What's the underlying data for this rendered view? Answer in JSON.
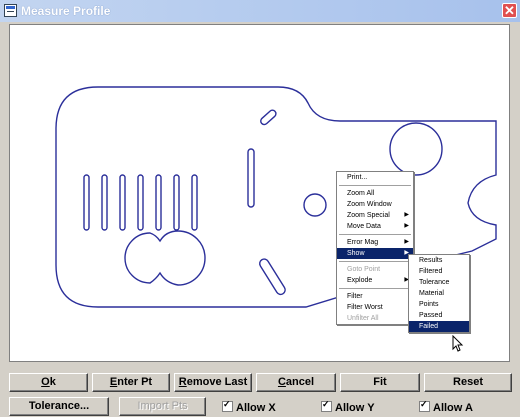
{
  "window": {
    "title": "Measure Profile",
    "close": "✕"
  },
  "context_menu": {
    "items": [
      {
        "label": "Print...",
        "state": "normal",
        "submenu": false
      },
      {
        "sep": true
      },
      {
        "label": "Zoom All",
        "state": "normal",
        "submenu": false
      },
      {
        "label": "Zoom Window",
        "state": "normal",
        "submenu": false
      },
      {
        "label": "Zoom Special",
        "state": "normal",
        "submenu": true
      },
      {
        "label": "Move Data",
        "state": "normal",
        "submenu": true
      },
      {
        "sep": true
      },
      {
        "label": "Error Mag",
        "state": "normal",
        "submenu": true
      },
      {
        "label": "Show",
        "state": "active",
        "submenu": true
      },
      {
        "sep": true
      },
      {
        "label": "Goto Point",
        "state": "disabled",
        "submenu": false
      },
      {
        "label": "Explode",
        "state": "normal",
        "submenu": true
      },
      {
        "sep": true
      },
      {
        "label": "Filter",
        "state": "normal",
        "submenu": false
      },
      {
        "label": "Filter Worst",
        "state": "normal",
        "submenu": false
      },
      {
        "label": "Unfilter All",
        "state": "disabled",
        "submenu": false
      }
    ]
  },
  "submenu": {
    "items": [
      {
        "label": "Results",
        "state": "normal"
      },
      {
        "label": "Filtered",
        "state": "normal"
      },
      {
        "label": "Tolerance",
        "state": "normal"
      },
      {
        "label": "Material",
        "state": "normal"
      },
      {
        "label": "Points",
        "state": "normal"
      },
      {
        "label": "Passed",
        "state": "normal"
      },
      {
        "label": "Failed",
        "state": "active"
      }
    ]
  },
  "buttons_row1": [
    {
      "key": "ok",
      "mn": "O",
      "rest": "k"
    },
    {
      "key": "enter-pt",
      "mn": "E",
      "rest": "nter Pt"
    },
    {
      "key": "remove-last",
      "mn": "R",
      "rest": "emove Last"
    },
    {
      "key": "cancel",
      "mn": "C",
      "rest": "ancel"
    },
    {
      "key": "fit",
      "mn": "",
      "rest": "Fit"
    },
    {
      "key": "reset",
      "mn": "",
      "rest": "Reset"
    }
  ],
  "buttons_row2": {
    "tolerance": "Tolerance...",
    "import_pts": "Import Pts"
  },
  "checkboxes": [
    {
      "key": "allow-x",
      "label": "Allow X",
      "checked": true
    },
    {
      "key": "allow-y",
      "label": "Allow Y",
      "checked": true
    },
    {
      "key": "allow-a",
      "label": "Allow A",
      "checked": true
    }
  ],
  "colors": {
    "profile": "#2b2f9a",
    "menu_highlight": "#0a246a"
  }
}
